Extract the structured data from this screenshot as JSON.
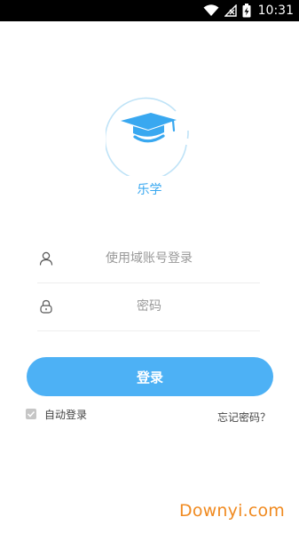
{
  "status_bar": {
    "time": "10:31",
    "icons": [
      "wifi-icon",
      "no-signal-icon",
      "battery-charging-icon"
    ]
  },
  "app": {
    "name": "乐学",
    "logo_icon": "graduation-cap-smile-icon"
  },
  "login_form": {
    "username_placeholder": "使用域账号登录",
    "password_placeholder": "密码",
    "username_icon": "user-icon",
    "password_icon": "lock-icon",
    "submit_label": "登录",
    "auto_login_label": "自动登录",
    "auto_login_checked": true,
    "forgot_password_label": "忘记密码？"
  },
  "watermark": "Downyi.com",
  "colors": {
    "accent": "#39a8f0",
    "button": "#4db1f5",
    "watermark": "#f08a20"
  }
}
